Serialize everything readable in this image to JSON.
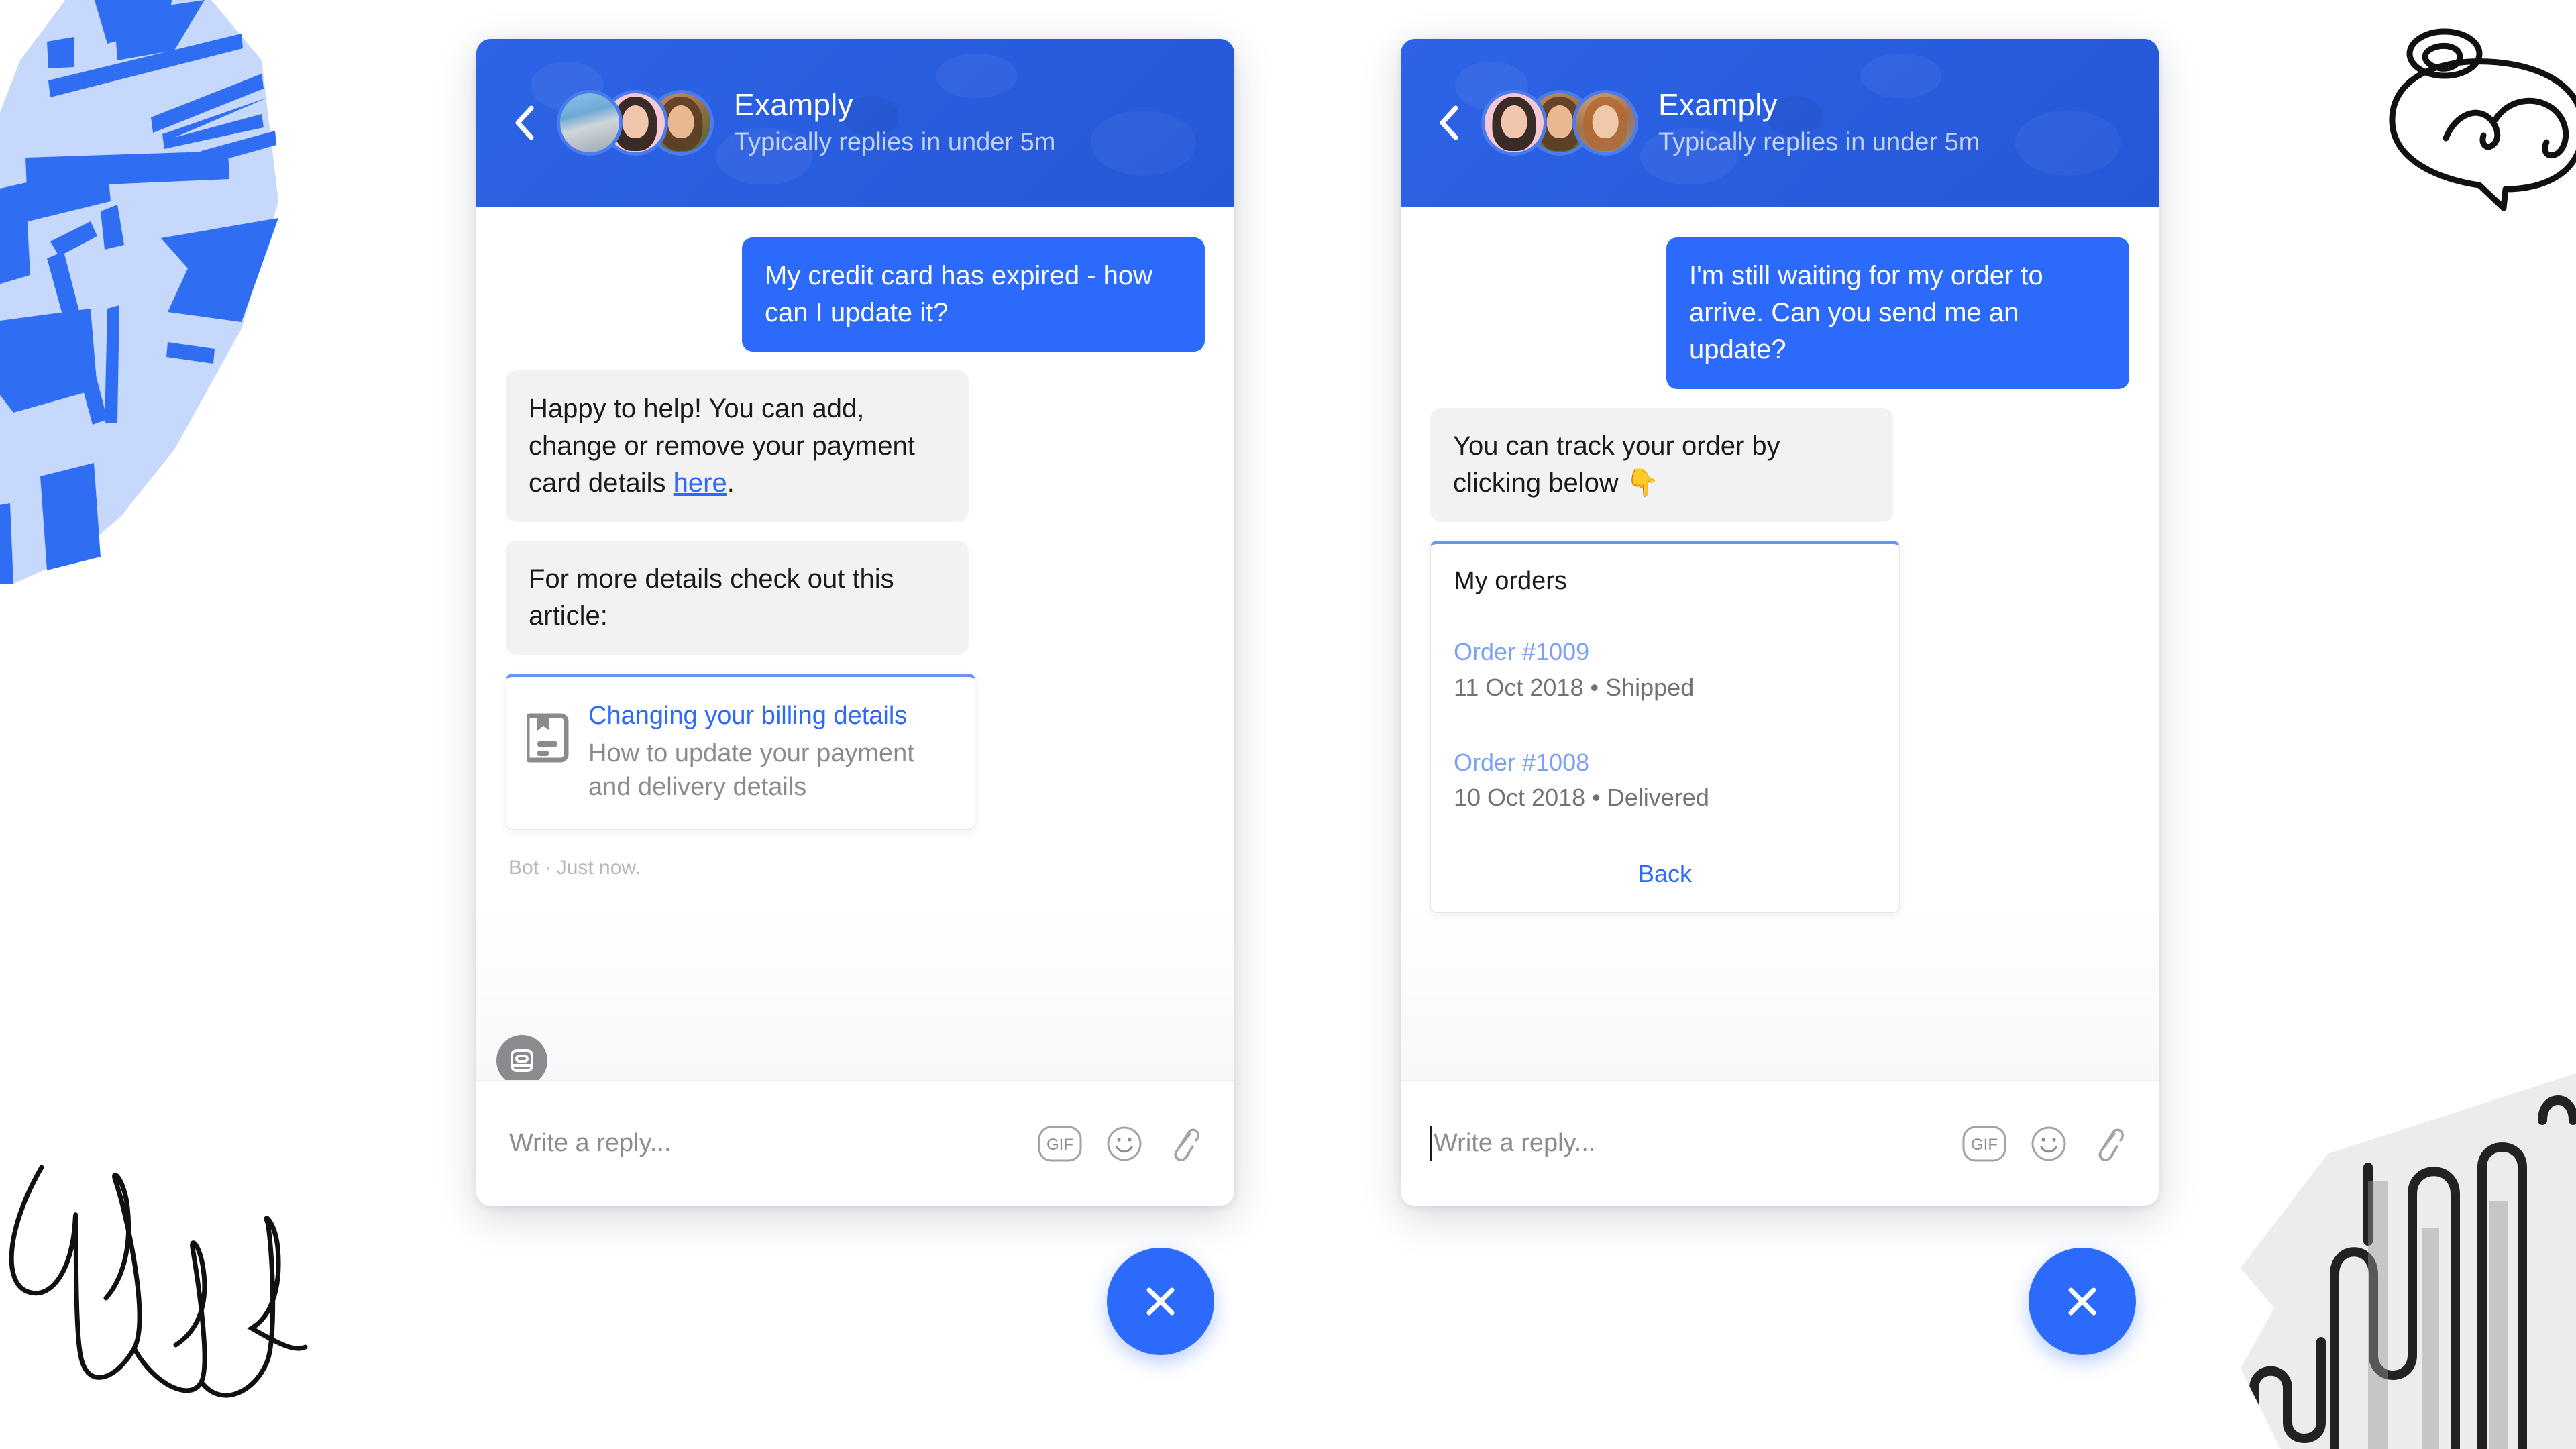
{
  "brand": {
    "accent_blue": "#2B6AFA",
    "header_blue": "#2A62E0",
    "bubble_in_bg": "#F2F2F3",
    "muted_text": "#8B8C8F",
    "card_top_border": "#6C93F7",
    "order_id_blue": "#7BA0F8"
  },
  "panels": [
    {
      "id": "billing-conversation",
      "header": {
        "back_icon": "chevron-left-icon",
        "title": "Examply",
        "subtitle": "Typically replies in under 5m",
        "avatars": [
          "avatar-photo-mountain",
          "avatar-photo-woman-pink",
          "avatar-photo-woman-outdoor"
        ]
      },
      "messages": [
        {
          "type": "bubble",
          "direction": "out",
          "text": "My credit card has expired - how can I update it?"
        },
        {
          "type": "bubble",
          "direction": "in",
          "text_before": "Happy to help! You can add, change or remove your payment card details ",
          "link_text": "here",
          "text_after": "."
        },
        {
          "type": "bubble",
          "direction": "in",
          "text": "For more details check out this article:"
        },
        {
          "type": "article-card",
          "icon": "article-document-icon",
          "title": "Changing your billing details",
          "description": "How to update your payment and delivery details"
        }
      ],
      "meta_line": "Bot · Just now.",
      "bot_avatar_icon": "bot-operator-icon",
      "composer": {
        "placeholder": "Write a reply...",
        "caret_visible": false,
        "actions": [
          {
            "icon": "gif-icon",
            "label": "GIF"
          },
          {
            "icon": "emoji-smiley-icon",
            "label": ""
          },
          {
            "icon": "paperclip-attachment-icon",
            "label": ""
          }
        ]
      }
    },
    {
      "id": "orders-conversation",
      "header": {
        "back_icon": "chevron-left-icon",
        "title": "Examply",
        "subtitle": "Typically replies in under 5m",
        "avatars": [
          "avatar-photo-woman-pink",
          "avatar-photo-woman-outdoor",
          "avatar-photo-man-beard"
        ]
      },
      "messages": [
        {
          "type": "bubble",
          "direction": "out",
          "text": "I'm still waiting for my order to arrive. Can you send me an update?"
        },
        {
          "type": "bubble",
          "direction": "in",
          "text": "You can track your order by clicking below 👇"
        }
      ],
      "orders_card": {
        "heading": "My orders",
        "items": [
          {
            "order_id": "Order #1009",
            "date": "11 Oct 2018",
            "separator": "•",
            "status": "Shipped"
          },
          {
            "order_id": "Order #1008",
            "date": "10 Oct 2018",
            "separator": "•",
            "status": "Delivered"
          }
        ],
        "back_label": "Back"
      },
      "bot_avatar_icon": "bot-operator-icon",
      "composer": {
        "placeholder": "Write a reply...",
        "caret_visible": true,
        "actions": [
          {
            "icon": "gif-icon",
            "label": "GIF"
          },
          {
            "icon": "emoji-smiley-icon",
            "label": ""
          },
          {
            "icon": "paperclip-attachment-icon",
            "label": ""
          }
        ]
      }
    }
  ],
  "launchers": [
    {
      "id": "launcher-left",
      "icon": "close-x-icon"
    },
    {
      "id": "launcher-right",
      "icon": "close-x-icon"
    }
  ],
  "decorations": [
    {
      "name": "abstract-blue-brush-artwork",
      "position": "top-left"
    },
    {
      "name": "cursive-scribble-doodle",
      "position": "bottom-left"
    },
    {
      "name": "speech-bubble-doodle",
      "position": "top-right"
    },
    {
      "name": "squiggle-pattern-artwork",
      "position": "bottom-right"
    }
  ]
}
